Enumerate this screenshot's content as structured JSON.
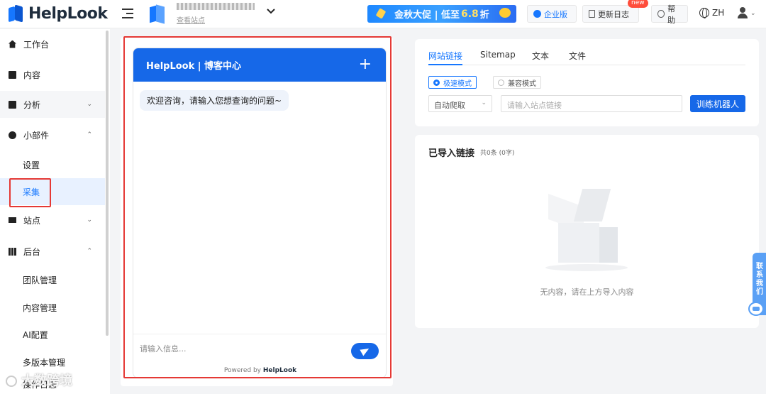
{
  "brand": {
    "name": "HelpLook"
  },
  "header": {
    "site_link": "查看站点",
    "promo_prefix": "金秋大促 | 低至",
    "promo_number": "6.8",
    "promo_suffix": "折",
    "enterprise_label": "企业版",
    "changelog_label": "更新日志",
    "new_badge": "new",
    "help_label": "帮助",
    "language": "ZH"
  },
  "sidebar": {
    "items": [
      {
        "label": "工作台"
      },
      {
        "label": "内容"
      },
      {
        "label": "分析"
      },
      {
        "label": "小部件"
      },
      {
        "label": "设置"
      },
      {
        "label": "采集"
      },
      {
        "label": "站点"
      },
      {
        "label": "后台"
      },
      {
        "label": "团队管理"
      },
      {
        "label": "内容管理"
      },
      {
        "label": "AI配置"
      },
      {
        "label": "多版本管理"
      },
      {
        "label": "操作日志"
      }
    ]
  },
  "chat": {
    "title": "HelpLook | 博客中心",
    "add_symbol": "+",
    "welcome": "欢迎咨询，请输入您想查询的问题~",
    "input_placeholder": "请输入信息...",
    "powered_prefix": "Powered by",
    "powered_brand": "HelpLook"
  },
  "import": {
    "tabs": [
      "网站链接",
      "Sitemap",
      "文本",
      "文件"
    ],
    "modes": [
      "极速模式",
      "兼容模式"
    ],
    "crawl_select": "自动爬取",
    "url_placeholder": "请输入站点链接",
    "train_button": "训练机器人"
  },
  "imported": {
    "title": "已导入链接",
    "count": "共0条 (0字)",
    "empty": "无内容，请在上方导入内容"
  },
  "contact": {
    "label": "联系我们"
  },
  "watermark": {
    "text": "大数跨境"
  }
}
